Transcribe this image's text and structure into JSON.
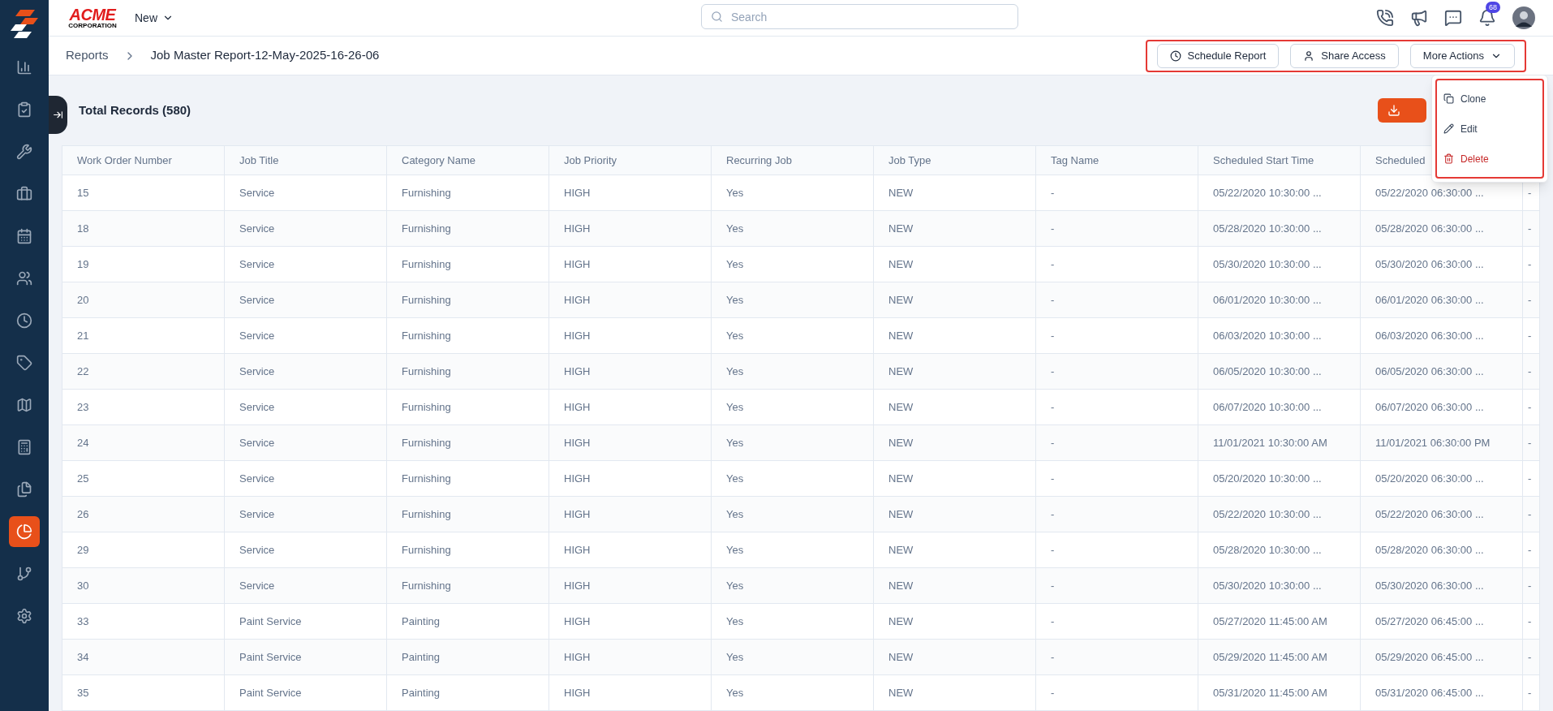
{
  "sidebar": {
    "items": [
      {
        "selected": false
      },
      {
        "selected": false
      },
      {
        "selected": false
      },
      {
        "selected": false
      },
      {
        "selected": false
      },
      {
        "selected": false
      },
      {
        "selected": false
      },
      {
        "selected": false
      },
      {
        "selected": false
      },
      {
        "selected": false
      },
      {
        "selected": false
      },
      {
        "selected": true
      },
      {
        "selected": false
      },
      {
        "selected": false
      }
    ]
  },
  "topbar": {
    "logo_text": "ACME",
    "logo_subtext": "CORPORATION",
    "new_menu": "New",
    "search": {
      "placeholder": "Search"
    },
    "notification_count": "68"
  },
  "breadcrumb": [
    "Reports",
    "Job Master Report-12-May-2025-16-26-06"
  ],
  "actions": [
    {
      "label": "Schedule Report"
    },
    {
      "label": "Share Access"
    },
    {
      "label": "More Actions"
    }
  ],
  "dropdown": [
    {
      "label": "Clone",
      "kind": "normal"
    },
    {
      "label": "Edit",
      "kind": "normal"
    },
    {
      "label": "Delete",
      "kind": "danger"
    }
  ],
  "total_records": "Total Records (580)",
  "table": {
    "columns": [
      "Work Order Number",
      "Job Title",
      "Category Name",
      "Job Priority",
      "Recurring Job",
      "Job Type",
      "Tag Name",
      "Scheduled Start Time",
      "Scheduled",
      ""
    ],
    "rows": [
      [
        "15",
        "Service",
        "Furnishing",
        "HIGH",
        "Yes",
        "NEW",
        "-",
        "05/22/2020 10:30:00 ...",
        "05/22/2020 06:30:00 ...",
        "-"
      ],
      [
        "18",
        "Service",
        "Furnishing",
        "HIGH",
        "Yes",
        "NEW",
        "-",
        "05/28/2020 10:30:00 ...",
        "05/28/2020 06:30:00 ...",
        "-"
      ],
      [
        "19",
        "Service",
        "Furnishing",
        "HIGH",
        "Yes",
        "NEW",
        "-",
        "05/30/2020 10:30:00 ...",
        "05/30/2020 06:30:00 ...",
        "-"
      ],
      [
        "20",
        "Service",
        "Furnishing",
        "HIGH",
        "Yes",
        "NEW",
        "-",
        "06/01/2020 10:30:00 ...",
        "06/01/2020 06:30:00 ...",
        "-"
      ],
      [
        "21",
        "Service",
        "Furnishing",
        "HIGH",
        "Yes",
        "NEW",
        "-",
        "06/03/2020 10:30:00 ...",
        "06/03/2020 06:30:00 ...",
        "-"
      ],
      [
        "22",
        "Service",
        "Furnishing",
        "HIGH",
        "Yes",
        "NEW",
        "-",
        "06/05/2020 10:30:00 ...",
        "06/05/2020 06:30:00 ...",
        "-"
      ],
      [
        "23",
        "Service",
        "Furnishing",
        "HIGH",
        "Yes",
        "NEW",
        "-",
        "06/07/2020 10:30:00 ...",
        "06/07/2020 06:30:00 ...",
        "-"
      ],
      [
        "24",
        "Service",
        "Furnishing",
        "HIGH",
        "Yes",
        "NEW",
        "-",
        "11/01/2021 10:30:00 AM",
        "11/01/2021 06:30:00 PM",
        "-"
      ],
      [
        "25",
        "Service",
        "Furnishing",
        "HIGH",
        "Yes",
        "NEW",
        "-",
        "05/20/2020 10:30:00 ...",
        "05/20/2020 06:30:00 ...",
        "-"
      ],
      [
        "26",
        "Service",
        "Furnishing",
        "HIGH",
        "Yes",
        "NEW",
        "-",
        "05/22/2020 10:30:00 ...",
        "05/22/2020 06:30:00 ...",
        "-"
      ],
      [
        "29",
        "Service",
        "Furnishing",
        "HIGH",
        "Yes",
        "NEW",
        "-",
        "05/28/2020 10:30:00 ...",
        "05/28/2020 06:30:00 ...",
        "-"
      ],
      [
        "30",
        "Service",
        "Furnishing",
        "HIGH",
        "Yes",
        "NEW",
        "-",
        "05/30/2020 10:30:00 ...",
        "05/30/2020 06:30:00 ...",
        "-"
      ],
      [
        "33",
        "Paint Service",
        "Painting",
        "HIGH",
        "Yes",
        "NEW",
        "-",
        "05/27/2020 11:45:00 AM",
        "05/27/2020 06:45:00 ...",
        "-"
      ],
      [
        "34",
        "Paint Service",
        "Painting",
        "HIGH",
        "Yes",
        "NEW",
        "-",
        "05/29/2020 11:45:00 AM",
        "05/29/2020 06:45:00 ...",
        "-"
      ],
      [
        "35",
        "Paint Service",
        "Painting",
        "HIGH",
        "Yes",
        "NEW",
        "-",
        "05/31/2020 11:45:00 AM",
        "05/31/2020 06:45:00 ...",
        "-"
      ]
    ]
  }
}
